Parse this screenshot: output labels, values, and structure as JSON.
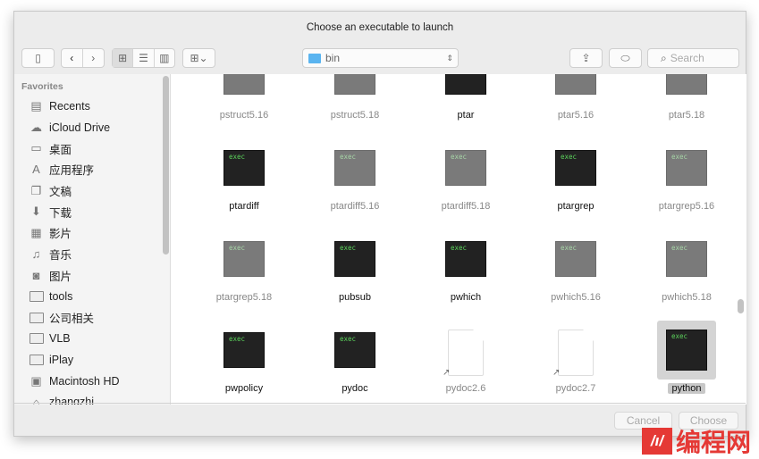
{
  "window": {
    "title": "Choose an executable to launch"
  },
  "toolbar": {
    "location": "bin",
    "search_placeholder": "Search"
  },
  "sidebar": {
    "section": "Favorites",
    "items": [
      {
        "label": "Recents",
        "icon": "recents-icon"
      },
      {
        "label": "iCloud Drive",
        "icon": "cloud-icon"
      },
      {
        "label": "桌面",
        "icon": "desktop-icon"
      },
      {
        "label": "应用程序",
        "icon": "applications-icon"
      },
      {
        "label": "文稿",
        "icon": "documents-icon"
      },
      {
        "label": "下载",
        "icon": "download-icon"
      },
      {
        "label": "影片",
        "icon": "film-icon"
      },
      {
        "label": "音乐",
        "icon": "music-icon"
      },
      {
        "label": "图片",
        "icon": "camera-icon"
      },
      {
        "label": "tools",
        "icon": "folder-icon"
      },
      {
        "label": "公司相关",
        "icon": "folder-icon"
      },
      {
        "label": "VLB",
        "icon": "folder-icon"
      },
      {
        "label": "iPlay",
        "icon": "folder-icon"
      },
      {
        "label": "Macintosh HD",
        "icon": "disk-icon"
      },
      {
        "label": "zhangzhi",
        "icon": "home-icon"
      }
    ]
  },
  "files": [
    {
      "name": "pstruct5.16",
      "kind": "exec",
      "enabled": false
    },
    {
      "name": "pstruct5.18",
      "kind": "exec",
      "enabled": false
    },
    {
      "name": "ptar",
      "kind": "exec",
      "enabled": true
    },
    {
      "name": "ptar5.16",
      "kind": "exec",
      "enabled": false
    },
    {
      "name": "ptar5.18",
      "kind": "exec",
      "enabled": false
    },
    {
      "name": "ptardiff",
      "kind": "exec",
      "enabled": true
    },
    {
      "name": "ptardiff5.16",
      "kind": "exec",
      "enabled": false
    },
    {
      "name": "ptardiff5.18",
      "kind": "exec",
      "enabled": false
    },
    {
      "name": "ptargrep",
      "kind": "exec",
      "enabled": true
    },
    {
      "name": "ptargrep5.16",
      "kind": "exec",
      "enabled": false
    },
    {
      "name": "ptargrep5.18",
      "kind": "exec",
      "enabled": false
    },
    {
      "name": "pubsub",
      "kind": "exec",
      "enabled": true
    },
    {
      "name": "pwhich",
      "kind": "exec",
      "enabled": true
    },
    {
      "name": "pwhich5.16",
      "kind": "exec",
      "enabled": false
    },
    {
      "name": "pwhich5.18",
      "kind": "exec",
      "enabled": false
    },
    {
      "name": "pwpolicy",
      "kind": "exec",
      "enabled": true
    },
    {
      "name": "pydoc",
      "kind": "exec",
      "enabled": true
    },
    {
      "name": "pydoc2.6",
      "kind": "alias",
      "enabled": false
    },
    {
      "name": "pydoc2.7",
      "kind": "alias",
      "enabled": false
    },
    {
      "name": "python",
      "kind": "exec",
      "enabled": true,
      "selected": true
    }
  ],
  "exec_label": "exec",
  "buttons": {
    "cancel": "Cancel",
    "choose": "Choose"
  },
  "watermark": {
    "logo": "编程网"
  }
}
